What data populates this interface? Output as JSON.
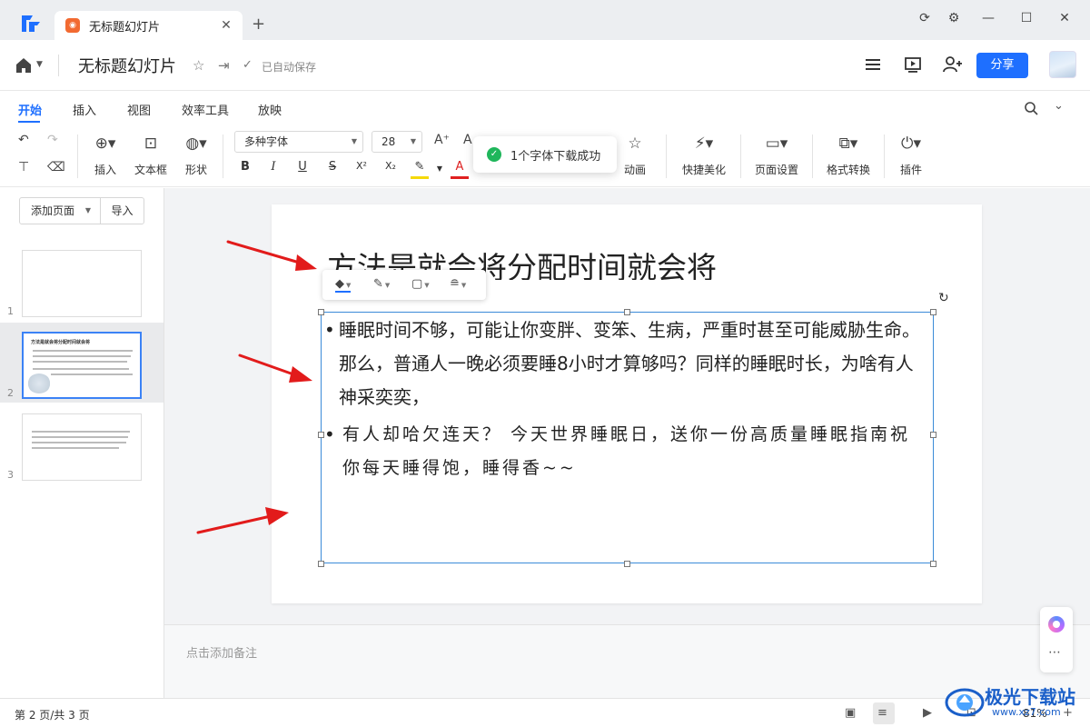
{
  "titlebar": {
    "tab_title": "无标题幻灯片",
    "tab_icon_glyph": "",
    "close_glyph": "✕",
    "new_tab_glyph": "+"
  },
  "header": {
    "doc_title": "无标题幻灯片",
    "autosave": "已自动保存",
    "share_label": "分享"
  },
  "menu": {
    "tabs": [
      "开始",
      "插入",
      "视图",
      "效率工具",
      "放映"
    ],
    "active_color": "#1e6fff"
  },
  "toolbar": {
    "insert_label": "插入",
    "textbox_label": "文本框",
    "shape_label": "形状",
    "font_name": "多种字体",
    "font_size": "28",
    "animation_label": "动画",
    "beautify_label": "快捷美化",
    "page_setup_label": "页面设置",
    "format_convert_label": "格式转换",
    "plugin_label": "插件",
    "bold": "B",
    "italic": "I",
    "underline": "U",
    "strike": "S",
    "superscript": "X²",
    "subscript": "X₂",
    "font_color_glyph": "A"
  },
  "toast": {
    "text": "1个字体下载成功",
    "color": "#1fb65b"
  },
  "left_panel": {
    "add_page_label": "添加页面",
    "import_label": "导入",
    "slides": [
      {
        "number": "1"
      },
      {
        "number": "2",
        "thumb_title": "方法是就会将分配时间就会将"
      },
      {
        "number": "3"
      }
    ]
  },
  "slide": {
    "title": "方法是就会将分配时间就会将",
    "bullets": [
      "睡眠时间不够，可能让你变胖、变笨、生病，严重时甚至可能威胁生命。那么，普通人一晚必须要睡8小时才算够吗？同样的睡眠时长，为啥有人神采奕奕，",
      "有人却哈欠连天？ 今天世界睡眠日，送你一份高质量睡眠指南祝你每天睡得饱，睡得香~~"
    ],
    "selection_color": "#3b8bd8"
  },
  "notes": {
    "placeholder": "点击添加备注"
  },
  "statusbar": {
    "page_status": "第 2 页/共 3 页",
    "zoom": "81%"
  },
  "annotations": {
    "arrow_color": "#e21b1b"
  },
  "watermark": {
    "name": "极光下载站",
    "url": "www.xz7.com"
  }
}
